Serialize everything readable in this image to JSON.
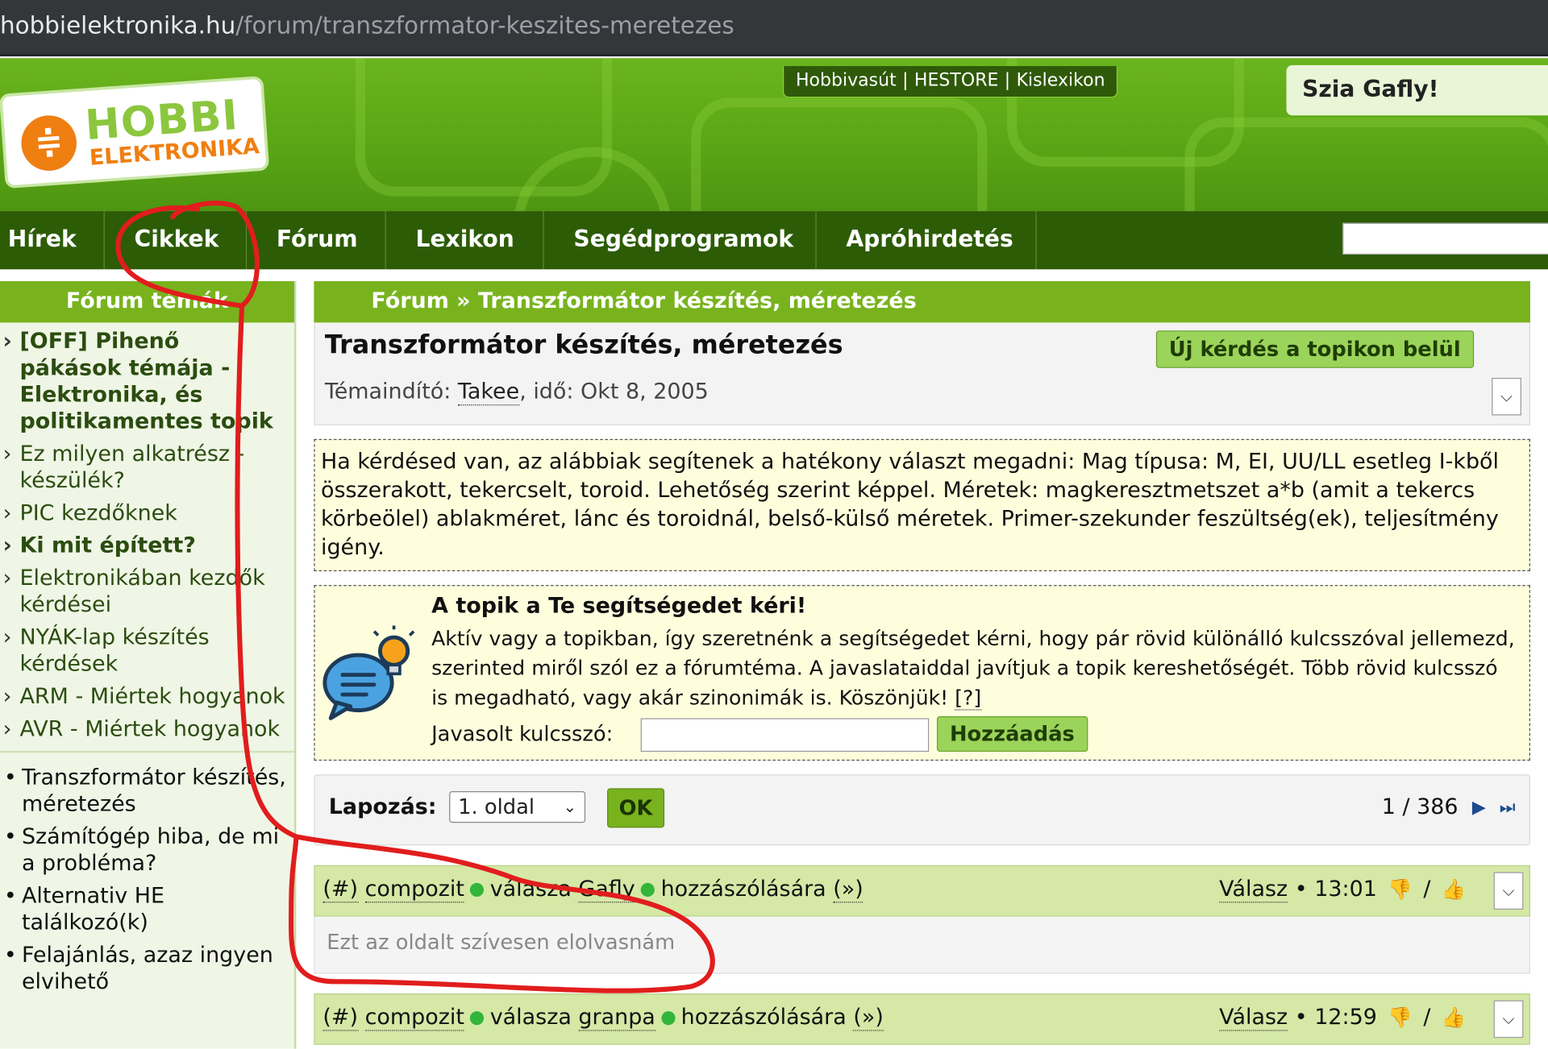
{
  "browser": {
    "url_host": "hobbielektronika.hu",
    "url_path": "/forum/transzformator-keszites-meretezes"
  },
  "header": {
    "logo_text_top": "HOBBI",
    "logo_text_bottom": "ELEKTRONIKA",
    "top_links": [
      "Hobbivasút",
      "HESTORE",
      "Kislexikon"
    ],
    "top_links_separator": "|",
    "greeting": "Szia Gafly!"
  },
  "nav": {
    "items": [
      "Hírek",
      "Cikkek",
      "Fórum",
      "Lexikon",
      "Segédprogramok",
      "Apróhirdetés"
    ]
  },
  "sidebar": {
    "title": "Fórum témák",
    "topics": [
      {
        "label": "[OFF] Pihenő pákások témája - Elektronika, és politikamentes topik",
        "bold": false
      },
      {
        "label": "Ez milyen alkatrész - készülék?",
        "bold": false
      },
      {
        "label": "PIC kezdőknek",
        "bold": false
      },
      {
        "label": "Ki mit épített?",
        "bold": true
      },
      {
        "label": "Elektronikában kezdők kérdései",
        "bold": false
      },
      {
        "label": "NYÁK-lap készítés kérdések",
        "bold": false
      },
      {
        "label": "ARM - Miértek hogyanok",
        "bold": false
      },
      {
        "label": "AVR - Miértek hogyanok",
        "bold": false
      }
    ],
    "recent": [
      "Transzformátor készítés, méretezés",
      "Számítógép hiba, de mi a probléma?",
      "Alternativ HE találkozó(k)",
      "Felajánlás, azaz ingyen elvihető"
    ]
  },
  "main": {
    "breadcrumb": "Fórum » Transzformátor készítés, méretezés",
    "title": "Transzformátor készítés, méretezés",
    "meta_prefix": "Témaindító: ",
    "meta_author": "Takee",
    "meta_suffix": ", idő: Okt 8, 2005",
    "new_question_button": "Új kérdés a topikon belül",
    "info_text": "Ha kérdésed van, az alábbiak segítenek a hatékony választ megadni: Mag típusa: M, EI, UU/LL esetleg I-kből összerakott, tekercselt, toroid. Lehetőség szerint képpel. Méretek: magkeresztmetszet a*b (amit a tekercs körbeölel) ablakméret, lánc és toroidnál, belső-külső méretek. Primer-szekunder feszültség(ek), teljesítmény igény.",
    "help": {
      "title": "A topik a Te segítségedet kéri!",
      "text": "Aktív vagy a topikban, így szeretnénk a segítségedet kérni, hogy pár rövid különálló kulcsszóval jellemezd, szerinted miről szól ez a fórumtéma. A javaslataiddal javítjuk a topik kereshetőségét. Több rövid kulcsszó is megadható, vagy akár szinonimák is. Köszönjük! ",
      "help_link": "[?]",
      "keyword_label": "Javasolt kulcsszó:",
      "keyword_value": "",
      "add_button": "Hozzáadás"
    },
    "pagination": {
      "label": "Lapozás:",
      "selected": "1. oldal",
      "ok": "OK",
      "count": "1 / 386"
    },
    "posts": [
      {
        "anchor": "(#)",
        "author": "compozit",
        "mid": "válasza",
        "reply_to": "Gafly",
        "suffix": "hozzászólására",
        "link": "(»)",
        "reply": "Válasz",
        "bullet": "•",
        "time": "13:01",
        "slash": "/",
        "body": "Ezt az oldalt szívesen elolvasnám"
      },
      {
        "anchor": "(#)",
        "author": "compozit",
        "mid": "válasza",
        "reply_to": "granpa",
        "suffix": "hozzászólására",
        "link": "(»)",
        "reply": "Válasz",
        "bullet": "•",
        "time": "12:59",
        "slash": "/",
        "body": ""
      }
    ]
  },
  "colors": {
    "accent_green": "#78b31e",
    "nav_dark": "#2d5c06",
    "annotation_red": "#e11d1d"
  }
}
